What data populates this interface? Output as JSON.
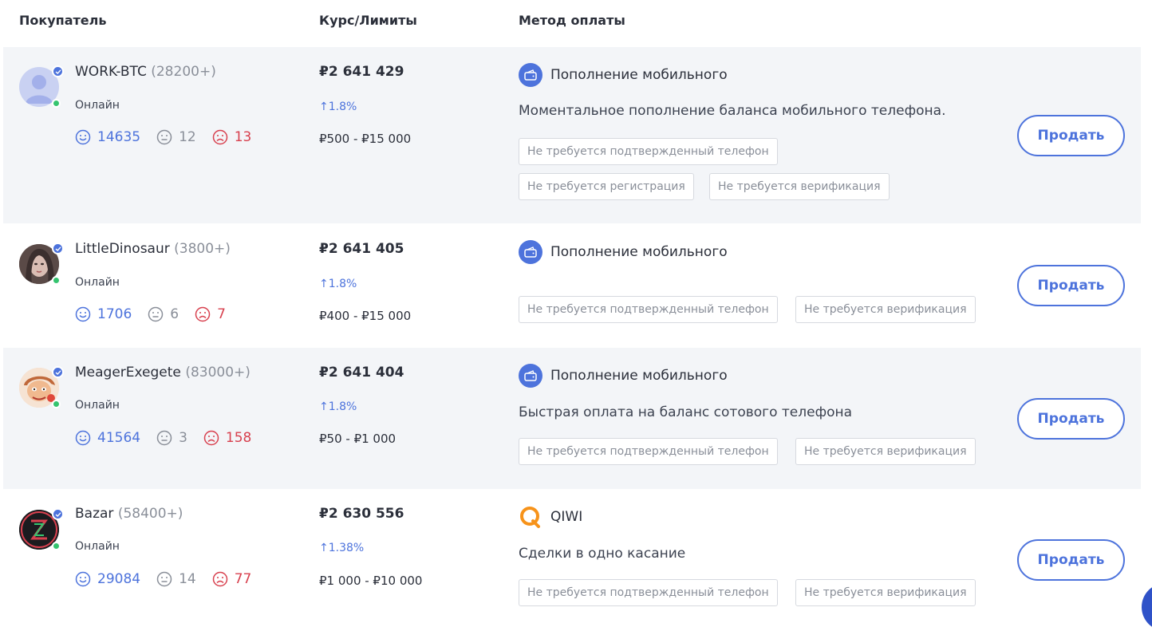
{
  "header": {
    "buyer": "Покупатель",
    "rate": "Курс/Лимиты",
    "method": "Метод оплаты"
  },
  "colors": {
    "accent": "#4d73dc",
    "online": "#35c46f",
    "negative": "#d8414f",
    "row_shade": "#f3f5f8",
    "qiwi": "#f7931a"
  },
  "rows": [
    {
      "name": "WORK-BTC",
      "count": "(28200+)",
      "status": "Онлайн",
      "positive": "14635",
      "neutral": "12",
      "negative": "13",
      "price": "₽2 641 429",
      "change": "↑1.8%",
      "limits": "₽500 - ₽15 000",
      "method": "Пополнение мобильного",
      "method_icon": "wallet-icon",
      "description": "Моментальное пополнение баланса мобильного телефона.",
      "tags": [
        "Не требуется подтвержденный телефон",
        "Не требуется регистрация",
        "Не требуется верификация"
      ],
      "button": "Продать"
    },
    {
      "name": "LittleDinosaur",
      "count": "(3800+)",
      "status": "Онлайн",
      "positive": "1706",
      "neutral": "6",
      "negative": "7",
      "price": "₽2 641 405",
      "change": "↑1.8%",
      "limits": "₽400 - ₽15 000",
      "method": "Пополнение мобильного",
      "method_icon": "wallet-icon",
      "tags": [
        "Не требуется подтвержденный телефон",
        "Не требуется верификация"
      ],
      "button": "Продать"
    },
    {
      "name": "MeagerExegete",
      "count": "(83000+)",
      "status": "Онлайн",
      "positive": "41564",
      "neutral": "3",
      "negative": "158",
      "price": "₽2 641 404",
      "change": "↑1.8%",
      "limits": "₽50 - ₽1 000",
      "method": "Пополнение мобильного",
      "method_icon": "wallet-icon",
      "description": "Быстрая оплата на баланс сотового телефона",
      "tags": [
        "Не требуется подтвержденный телефон",
        "Не требуется верификация"
      ],
      "button": "Продать"
    },
    {
      "name": "Bazar",
      "count": "(58400+)",
      "status": "Онлайн",
      "positive": "29084",
      "neutral": "14",
      "negative": "77",
      "price": "₽2 630 556",
      "change": "↑1.38%",
      "limits": "₽1 000 - ₽10 000",
      "method": "QIWI",
      "method_icon": "qiwi-logo-icon",
      "description": "Сделки в одно касание",
      "tags": [
        "Не требуется подтвержденный телефон",
        "Не требуется верификация"
      ],
      "button": "Продать"
    }
  ]
}
